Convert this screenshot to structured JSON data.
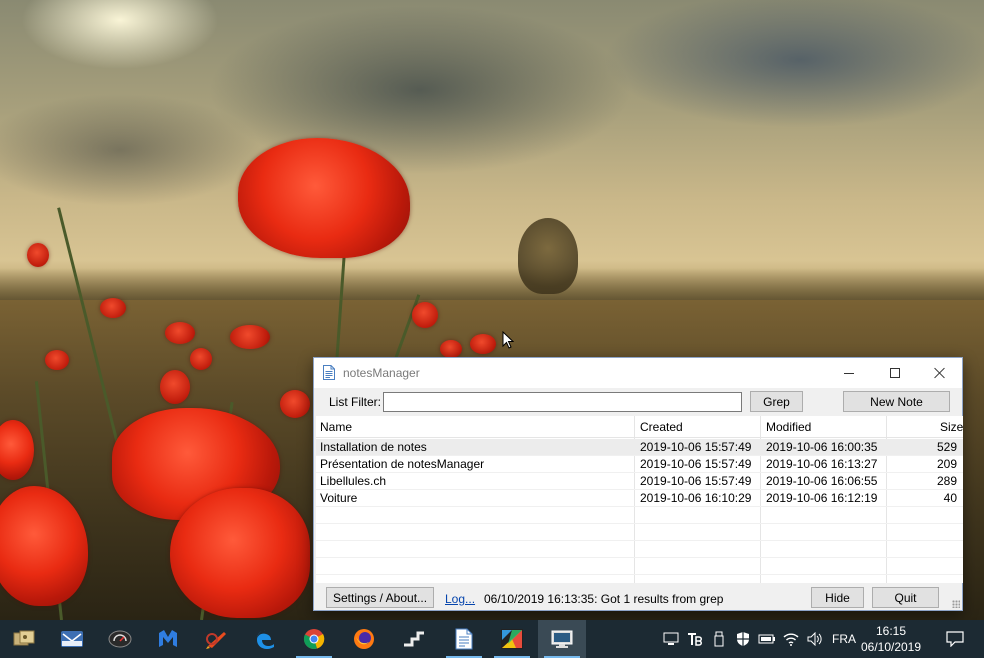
{
  "window": {
    "title": "notesManager"
  },
  "filter": {
    "label": "List Filter:",
    "value": "",
    "placeholder": ""
  },
  "buttons": {
    "grep": "Grep",
    "new_note": "New Note",
    "settings": "Settings / About...",
    "hide": "Hide",
    "quit": "Quit"
  },
  "list": {
    "columns": {
      "name": "Name",
      "created": "Created",
      "modified": "Modified",
      "size": "Size"
    },
    "rows": [
      {
        "name": "Installation de notes",
        "created": "2019-10-06  15:57:49",
        "modified": "2019-10-06  16:00:35",
        "size": "529",
        "selected": true
      },
      {
        "name": "Présentation de notesManager",
        "created": "2019-10-06  15:57:49",
        "modified": "2019-10-06  16:13:27",
        "size": "209",
        "selected": false
      },
      {
        "name": "Libellules.ch",
        "created": "2019-10-06  15:57:49",
        "modified": "2019-10-06  16:06:55",
        "size": "289",
        "selected": false
      },
      {
        "name": "Voiture",
        "created": "2019-10-06  16:10:29",
        "modified": "2019-10-06  16:12:19",
        "size": "40",
        "selected": false
      }
    ]
  },
  "status": {
    "log_link": "Log...",
    "message": "06/10/2019 16:13:35: Got 1 results from grep"
  },
  "taskbar": {
    "apps": [
      {
        "name": "task-view-icon"
      },
      {
        "name": "mail-app-icon"
      },
      {
        "name": "gauge-app-icon"
      },
      {
        "name": "malwarebytes-icon"
      },
      {
        "name": "ccleaner-icon"
      },
      {
        "name": "edge-icon"
      },
      {
        "name": "chrome-icon"
      },
      {
        "name": "firefox-icon"
      },
      {
        "name": "terminal-icon"
      },
      {
        "name": "notes-app-icon"
      },
      {
        "name": "paint-app-icon"
      },
      {
        "name": "remote-desktop-icon"
      }
    ],
    "language": "FRA",
    "time": "16:15",
    "date": "06/10/2019"
  },
  "colors": {
    "taskbar_bg": "#1c2a33",
    "link": "#0645ad",
    "selected_row": "#ececec"
  }
}
